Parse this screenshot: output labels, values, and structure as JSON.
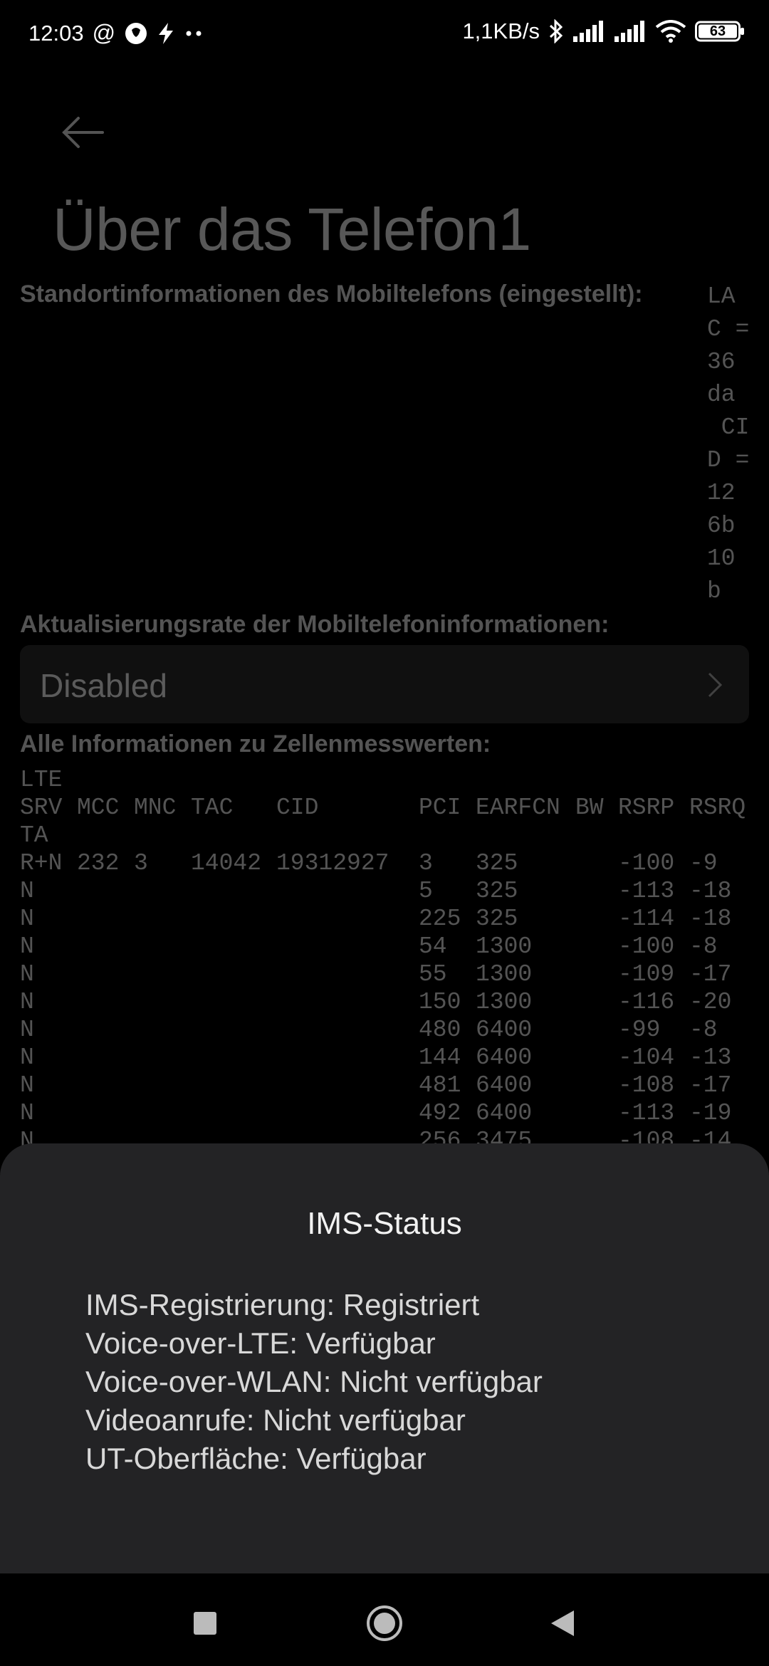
{
  "status_bar": {
    "time": "12:03",
    "left_icons": [
      "at-icon",
      "brain-icon",
      "lightning-icon",
      "more-dots-icon"
    ],
    "net_speed": "1,1KB/s",
    "right_icons": [
      "bluetooth-icon",
      "signal-icon",
      "signal-icon",
      "wifi-icon",
      "battery-icon"
    ],
    "battery_level": "63"
  },
  "page": {
    "title": "Über das Telefon1",
    "location_label": "Standortinformationen des Mobiltelefons (eingestellt):",
    "location_value": "LA\nC =\n36\nda\n CI\nD =\n12\n6b\n10\nb",
    "rate_label": "Aktualisierungsrate der Mobiltelefoninformationen:",
    "rate_value": "Disabled",
    "cell_label": "Alle Informationen zu Zellenmesswerten:",
    "cell_tech": "LTE",
    "cell_headers": [
      "SRV",
      "MCC",
      "MNC",
      "TAC",
      "CID",
      "PCI",
      "EARFCN",
      "BW",
      "RSRP",
      "RSRQ"
    ],
    "cell_header_wrap": "TA",
    "cell_rows": [
      {
        "srv": "R+N",
        "mcc": "232",
        "mnc": "3",
        "tac": "14042",
        "cid": "19312927",
        "pci": "3",
        "earfcn": "325",
        "bw": "",
        "rsrp": "-100",
        "rsrq": "-9"
      },
      {
        "srv": "N",
        "mcc": "",
        "mnc": "",
        "tac": "",
        "cid": "",
        "pci": "5",
        "earfcn": "325",
        "bw": "",
        "rsrp": "-113",
        "rsrq": "-18"
      },
      {
        "srv": "N",
        "mcc": "",
        "mnc": "",
        "tac": "",
        "cid": "",
        "pci": "225",
        "earfcn": "325",
        "bw": "",
        "rsrp": "-114",
        "rsrq": "-18"
      },
      {
        "srv": "N",
        "mcc": "",
        "mnc": "",
        "tac": "",
        "cid": "",
        "pci": "54",
        "earfcn": "1300",
        "bw": "",
        "rsrp": "-100",
        "rsrq": "-8"
      },
      {
        "srv": "N",
        "mcc": "",
        "mnc": "",
        "tac": "",
        "cid": "",
        "pci": "55",
        "earfcn": "1300",
        "bw": "",
        "rsrp": "-109",
        "rsrq": "-17"
      },
      {
        "srv": "N",
        "mcc": "",
        "mnc": "",
        "tac": "",
        "cid": "",
        "pci": "150",
        "earfcn": "1300",
        "bw": "",
        "rsrp": "-116",
        "rsrq": "-20"
      },
      {
        "srv": "N",
        "mcc": "",
        "mnc": "",
        "tac": "",
        "cid": "",
        "pci": "480",
        "earfcn": "6400",
        "bw": "",
        "rsrp": "-99",
        "rsrq": "-8"
      },
      {
        "srv": "N",
        "mcc": "",
        "mnc": "",
        "tac": "",
        "cid": "",
        "pci": "144",
        "earfcn": "6400",
        "bw": "",
        "rsrp": "-104",
        "rsrq": "-13"
      },
      {
        "srv": "N",
        "mcc": "",
        "mnc": "",
        "tac": "",
        "cid": "",
        "pci": "481",
        "earfcn": "6400",
        "bw": "",
        "rsrp": "-108",
        "rsrq": "-17"
      },
      {
        "srv": "N",
        "mcc": "",
        "mnc": "",
        "tac": "",
        "cid": "",
        "pci": "492",
        "earfcn": "6400",
        "bw": "",
        "rsrp": "-113",
        "rsrq": "-19"
      },
      {
        "srv": "N",
        "mcc": "",
        "mnc": "",
        "tac": "",
        "cid": "",
        "pci": "256",
        "earfcn": "3475",
        "bw": "",
        "rsrp": "-108",
        "rsrq": "-14"
      }
    ]
  },
  "dialog": {
    "title": "IMS-Status",
    "lines": [
      "IMS-Registrierung: Registriert",
      "Voice-over-LTE: Verfügbar",
      "Voice-over-WLAN: Nicht verfügbar",
      "Videoanrufe: Nicht verfügbar",
      "UT-Oberfläche: Verfügbar"
    ]
  },
  "navbar": {
    "buttons": [
      "recents-square-icon",
      "home-circle-icon",
      "back-triangle-icon"
    ]
  }
}
